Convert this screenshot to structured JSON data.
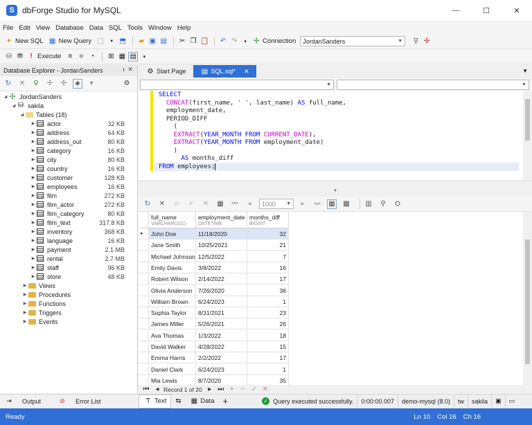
{
  "window": {
    "title": "dbForge Studio for MySQL"
  },
  "menu": [
    "File",
    "Edit",
    "View",
    "Database",
    "Data",
    "SQL",
    "Tools",
    "Window",
    "Help"
  ],
  "toolbar1": {
    "new_sql": "New SQL",
    "new_query": "New Query",
    "connection_label": "Connection",
    "connection_value": "JordanSanders"
  },
  "toolbar2": {
    "execute": "Execute"
  },
  "explorer": {
    "title": "Database Explorer - JordanSanders",
    "connection": "JordanSanders",
    "database": "sakila",
    "tables_label": "Tables (18)",
    "tables": [
      {
        "name": "actor",
        "size": "32 KB"
      },
      {
        "name": "address",
        "size": "64 KB"
      },
      {
        "name": "address_out",
        "size": "80 KB"
      },
      {
        "name": "category",
        "size": "16 KB"
      },
      {
        "name": "city",
        "size": "80 KB"
      },
      {
        "name": "country",
        "size": "16 KB"
      },
      {
        "name": "customer",
        "size": "128 KB"
      },
      {
        "name": "employees",
        "size": "16 KB"
      },
      {
        "name": "film",
        "size": "272 KB"
      },
      {
        "name": "film_actor",
        "size": "272 KB"
      },
      {
        "name": "film_category",
        "size": "80 KB"
      },
      {
        "name": "film_text",
        "size": "317.8 KB"
      },
      {
        "name": "inventory",
        "size": "368 KB"
      },
      {
        "name": "language",
        "size": "16 KB"
      },
      {
        "name": "payment",
        "size": "2.1 MB"
      },
      {
        "name": "rental",
        "size": "2.7 MB"
      },
      {
        "name": "staff",
        "size": "96 KB"
      },
      {
        "name": "store",
        "size": "48 KB"
      }
    ],
    "folders": [
      "Views",
      "Procedures",
      "Functions",
      "Triggers",
      "Events"
    ]
  },
  "bottom_tabs": {
    "output": "Output",
    "error_list": "Error List"
  },
  "doc_tabs": {
    "start_page": "Start Page",
    "sql": "SQL.sql*"
  },
  "grid": {
    "columns": [
      {
        "name": "full_name",
        "type": "VARCHAR(101)"
      },
      {
        "name": "employment_date",
        "type": "DATETIME"
      },
      {
        "name": "months_diff",
        "type": "BIGINT"
      }
    ],
    "rows": [
      [
        "John Doe",
        "11/18/2020",
        "32"
      ],
      [
        "Jane Smith",
        "10/25/2021",
        "21"
      ],
      [
        "Michael Johnson",
        "12/5/2022",
        "7"
      ],
      [
        "Emily Davis",
        "3/8/2022",
        "16"
      ],
      [
        "Robert Wilson",
        "2/14/2022",
        "17"
      ],
      [
        "Olivia Anderson",
        "7/26/2020",
        "36"
      ],
      [
        "William Brown",
        "6/24/2023",
        "1"
      ],
      [
        "Sophia Taylor",
        "8/31/2021",
        "23"
      ],
      [
        "James Miller",
        "5/26/2021",
        "26"
      ],
      [
        "Ava Thomas",
        "1/3/2022",
        "18"
      ],
      [
        "David Walker",
        "4/28/2022",
        "15"
      ],
      [
        "Emma Harris",
        "2/2/2022",
        "17"
      ],
      [
        "Daniel Clark",
        "6/24/2023",
        "1"
      ],
      [
        "Mia Lewis",
        "8/7/2020",
        "35"
      ]
    ],
    "page_size": "1000"
  },
  "nav": {
    "record": "Record 1 of 20"
  },
  "result_bar": {
    "text_tab": "Text",
    "data_tab": "Data",
    "status": "Query executed successfully.",
    "time": "0:00:00.007",
    "server": "demo-mysql (8.0)",
    "user_short": "tw",
    "schema": "sakila"
  },
  "status": {
    "ready": "Ready",
    "ln": "Ln 10",
    "col": "Col 16",
    "ch": "Ch 16"
  },
  "colors": {
    "accent": "#2f6fd6",
    "keyword": "#0000ff",
    "function": "#c400c4",
    "success": "#1f9d3a"
  }
}
